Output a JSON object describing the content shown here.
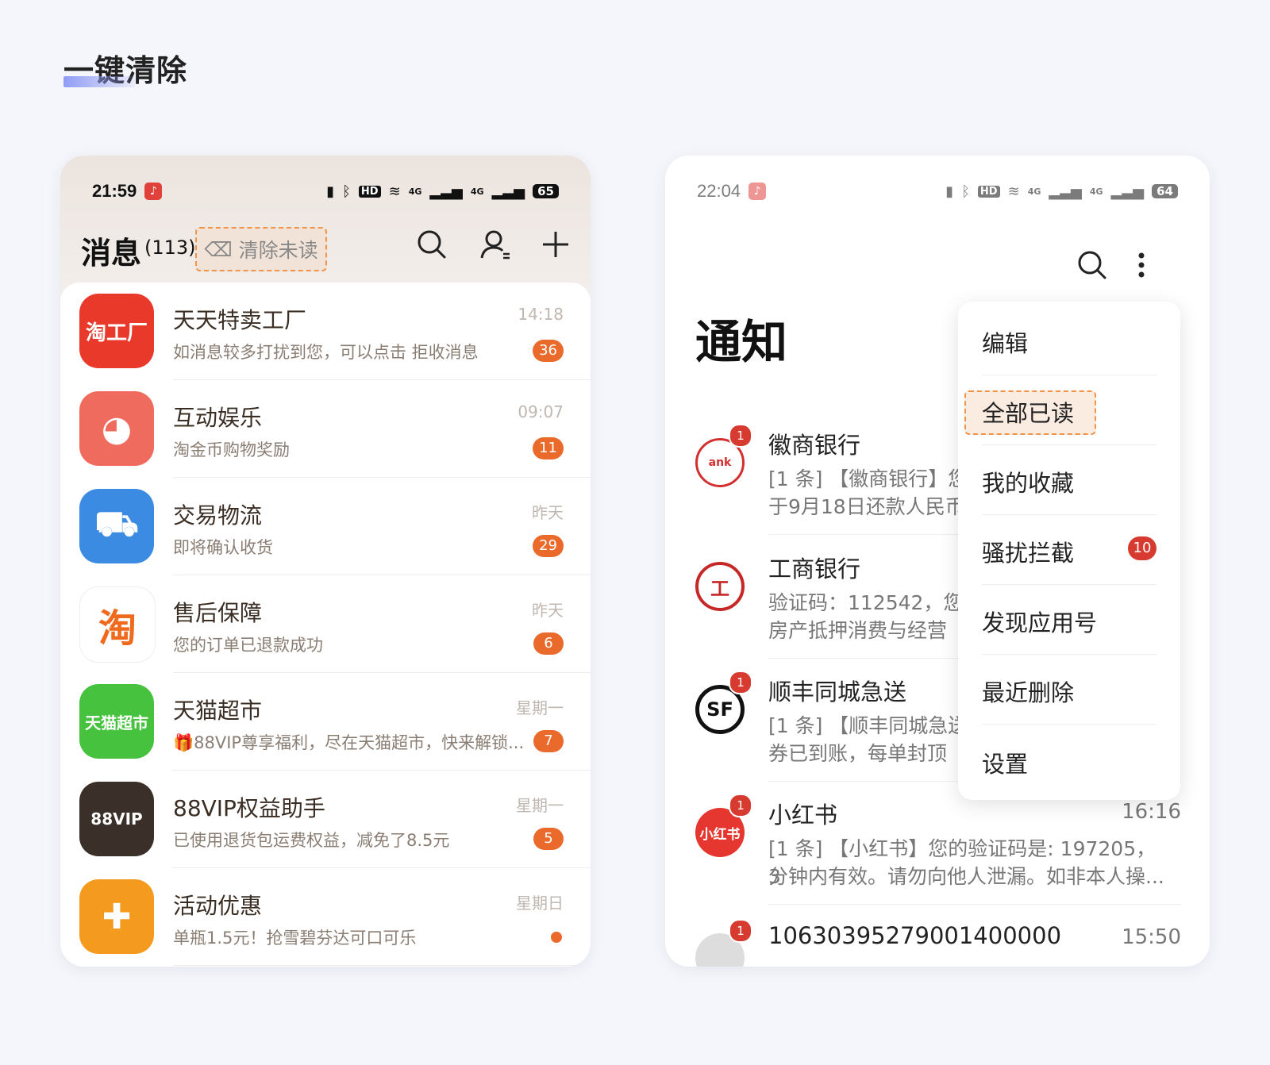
{
  "page": {
    "title": "一键清除"
  },
  "left_phone": {
    "status": {
      "time": "21:59",
      "battery": "65",
      "network_1": "4G",
      "network_2": "4G",
      "hd": "HD"
    },
    "header": {
      "title": "消息",
      "count": "(113)",
      "clear_label": "清除未读"
    },
    "messages": [
      {
        "name": "天天特卖工厂",
        "sub": "如消息较多打扰到您，可以点击 拒收消息",
        "time": "14:18",
        "badge": "36",
        "icon_text": "淘工厂",
        "icon_color": "#e8392b"
      },
      {
        "name": "互动娱乐",
        "sub": "淘金币购物奖励",
        "time": "09:07",
        "badge": "11",
        "icon_text": "",
        "icon_color": "#ef6b5d"
      },
      {
        "name": "交易物流",
        "sub": "即将确认收货",
        "time": "昨天",
        "badge": "29",
        "icon_text": "",
        "icon_color": "#3b8be2"
      },
      {
        "name": "售后保障",
        "sub": "您的订单已退款成功",
        "time": "昨天",
        "badge": "6",
        "icon_text": "淘",
        "icon_color": "#ffffff"
      },
      {
        "name": "天猫超市",
        "sub": "🎁88VIP尊享福利，尽在天猫超市，快来解锁...",
        "time": "星期一",
        "badge": "7",
        "icon_text": "天猫超市",
        "icon_color": "#46c23f"
      },
      {
        "name": "88VIP权益助手",
        "sub": "已使用退货包运费权益，减免了8.5元",
        "time": "星期一",
        "badge": "5",
        "icon_text": "88VIP",
        "icon_color": "#3a3029"
      },
      {
        "name": "活动优惠",
        "sub": "单瓶1.5元！抢雪碧芬达可口可乐",
        "time": "星期日",
        "badge": "",
        "icon_text": "",
        "icon_color": "#f39a1f"
      }
    ]
  },
  "right_phone": {
    "status": {
      "time": "22:04",
      "battery": "64",
      "network_1": "4G",
      "network_2": "4G",
      "hd": "HD"
    },
    "title": "通知",
    "notifications": [
      {
        "name": "徽商银行",
        "line1": "[1 条] 【徽商银行】您",
        "line2": "于9月18日还款人民币",
        "time": "",
        "badge": "1",
        "icon_text": "ank"
      },
      {
        "name": "工商银行",
        "line1": "验证码：112542，您",
        "line2": "房产抵押消费与经营",
        "time": "",
        "badge": "",
        "icon_text": "工"
      },
      {
        "name": "顺丰同城急送",
        "line1": "[1 条] 【顺丰同城急送",
        "line2": "券已到账，每单封顶",
        "time": "",
        "badge": "1",
        "icon_text": "SF"
      },
      {
        "name": "小红书",
        "line1": "[1 条] 【小红书】您的验证码是: 197205， 3",
        "line2": "分钟内有效。请勿向他人泄漏。如非本人操...",
        "time": "16:16",
        "badge": "1",
        "icon_text": "小红书"
      },
      {
        "name": "10630395279001400000",
        "line1": "",
        "line2": "",
        "time": "15:50",
        "badge": "1",
        "icon_text": ""
      }
    ],
    "menu": {
      "items": [
        "编辑",
        "全部已读",
        "我的收藏",
        "骚扰拦截",
        "发现应用号",
        "最近删除",
        "设置"
      ],
      "spam_badge": "10"
    }
  }
}
